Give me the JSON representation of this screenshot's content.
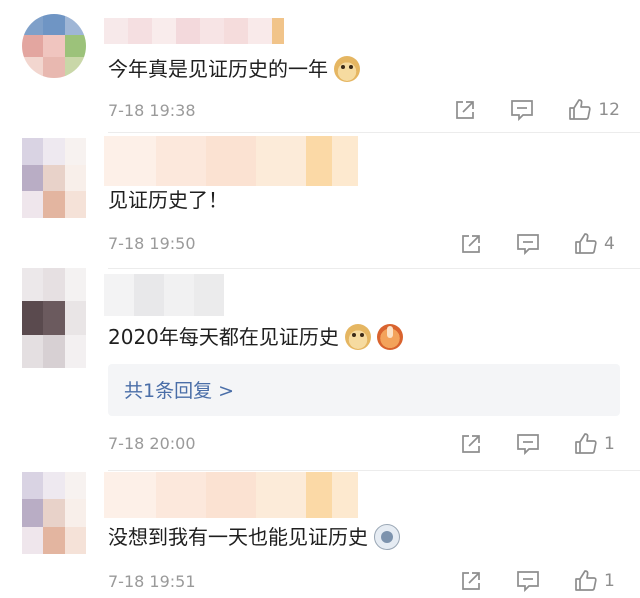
{
  "comments": [
    {
      "text": "今年真是见证历史的一年",
      "emojis": [
        "doge"
      ],
      "time": "7-18 19:38",
      "likes": "12"
    },
    {
      "text": "见证历史了！",
      "emojis": [],
      "time": "7-18 19:50",
      "likes": "4"
    },
    {
      "text": "2020年每天都在见证历史",
      "emojis": [
        "doge",
        "pray"
      ],
      "time": "7-18 20:00",
      "likes": "1",
      "reply_summary": "共1条回复 >"
    },
    {
      "text": "没想到我有一天也能见证历史",
      "emojis": [
        "bot"
      ],
      "time": "7-18 19:51",
      "likes": "1"
    }
  ],
  "icons": {
    "share": "share-icon",
    "comment": "comment-icon",
    "like": "thumbs-up-icon"
  },
  "colors": {
    "link": "#4a6ea8",
    "meta": "#9a9a9a",
    "icon": "#8e8e8e"
  }
}
